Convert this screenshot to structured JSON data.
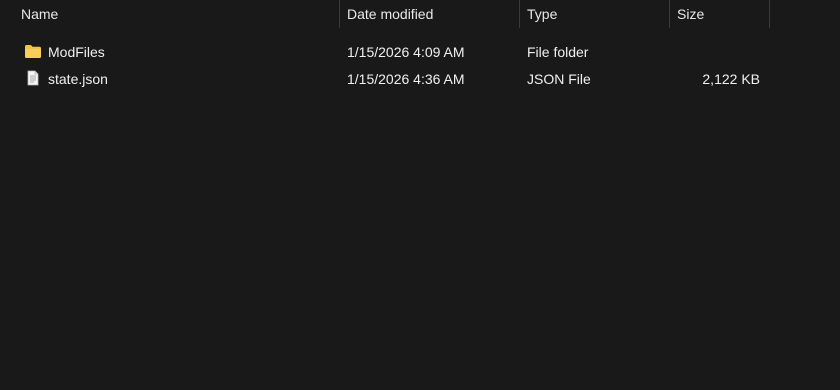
{
  "columns": {
    "name": "Name",
    "date_modified": "Date modified",
    "type": "Type",
    "size": "Size"
  },
  "files": [
    {
      "name": "ModFiles",
      "date_modified": "1/15/2026 4:09 AM",
      "type": "File folder",
      "size": "",
      "icon": "folder-icon"
    },
    {
      "name": "state.json",
      "date_modified": "1/15/2026 4:36 AM",
      "type": "JSON File",
      "size": "2,122 KB",
      "icon": "file-icon"
    }
  ],
  "colors": {
    "background": "#191919",
    "text": "#f0f0f0",
    "folder": "#f2c14e"
  }
}
